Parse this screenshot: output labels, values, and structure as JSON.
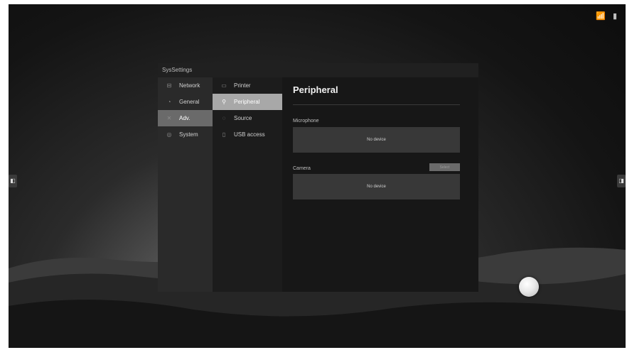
{
  "window": {
    "title": "SysSettings"
  },
  "sidebar": {
    "items": [
      {
        "label": "Network",
        "icon": "network-icon",
        "active": false
      },
      {
        "label": "General",
        "icon": "general-icon",
        "active": false
      },
      {
        "label": "Adv.",
        "icon": "advanced-icon",
        "active": true
      },
      {
        "label": "System",
        "icon": "system-icon",
        "active": false
      }
    ]
  },
  "subnav": {
    "items": [
      {
        "label": "Printer",
        "icon": "printer-icon",
        "active": false
      },
      {
        "label": "Peripheral",
        "icon": "peripheral-icon",
        "active": true
      },
      {
        "label": "Source",
        "icon": "source-icon",
        "active": false
      },
      {
        "label": "USB access",
        "icon": "usb-icon",
        "active": false
      }
    ]
  },
  "content": {
    "title": "Peripheral",
    "microphone": {
      "label": "Microphone",
      "status": "No device"
    },
    "camera": {
      "label": "Camera",
      "status": "No device",
      "select_label": "Select"
    }
  },
  "colors": {
    "active_main": "#6a6a6a",
    "active_sub": "#a8a8a8",
    "panel": "#171717"
  }
}
